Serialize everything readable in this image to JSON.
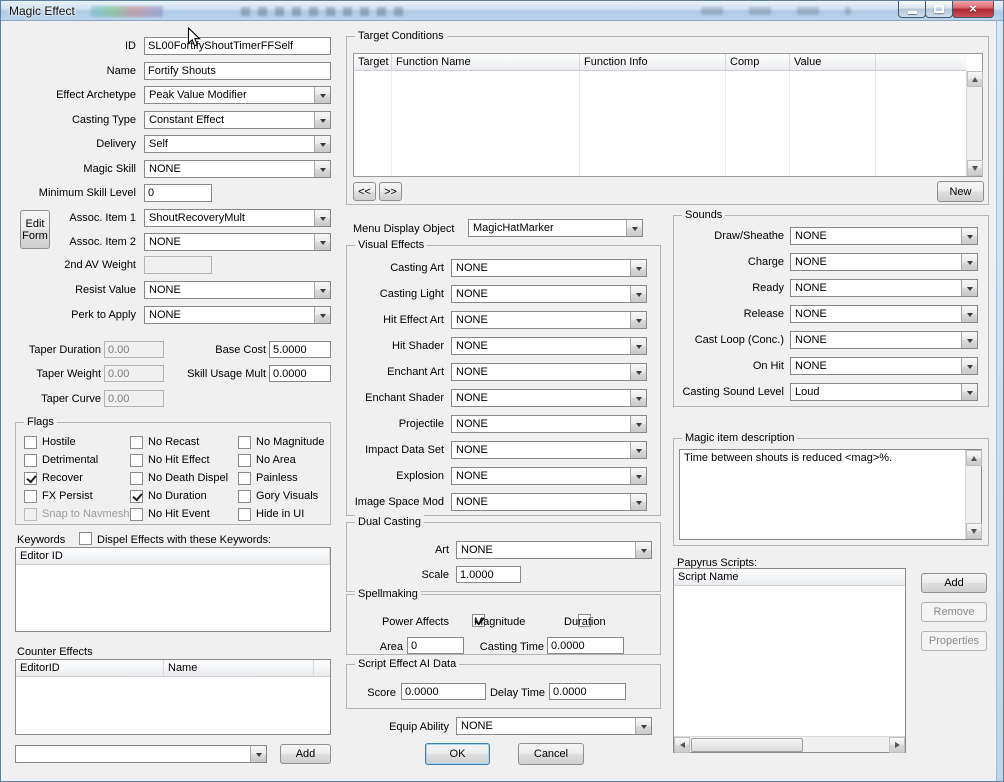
{
  "window": {
    "title": "Magic Effect"
  },
  "left": {
    "id": {
      "label": "ID",
      "value": "SL00FortifyShoutTimerFFSelf"
    },
    "name": {
      "label": "Name",
      "value": "Fortify Shouts"
    },
    "effect_archetype": {
      "label": "Effect Archetype",
      "value": "Peak Value Modifier"
    },
    "casting_type": {
      "label": "Casting Type",
      "value": "Constant Effect"
    },
    "delivery": {
      "label": "Delivery",
      "value": "Self"
    },
    "magic_skill": {
      "label": "Magic Skill",
      "value": "NONE"
    },
    "minimum_skill_level": {
      "label": "Minimum Skill Level",
      "value": "0"
    },
    "edit_form_button": "Edit Form",
    "assoc_item_1": {
      "label": "Assoc. Item 1",
      "value": "ShoutRecoveryMult"
    },
    "assoc_item_2": {
      "label": "Assoc. Item 2",
      "value": "NONE"
    },
    "second_av_weight": {
      "label": "2nd AV Weight",
      "value": ""
    },
    "resist_value": {
      "label": "Resist Value",
      "value": "NONE"
    },
    "perk_to_apply": {
      "label": "Perk to Apply",
      "value": "NONE"
    },
    "taper_duration": {
      "label": "Taper Duration",
      "value": "0.00"
    },
    "taper_weight": {
      "label": "Taper Weight",
      "value": "0.00"
    },
    "taper_curve": {
      "label": "Taper Curve",
      "value": "0.00"
    },
    "base_cost": {
      "label": "Base Cost",
      "value": "5.0000"
    },
    "skill_usage_mult": {
      "label": "Skill Usage Mult",
      "value": "0.0000"
    }
  },
  "flags": {
    "title": "Flags",
    "columns": [
      [
        {
          "label": "Hostile",
          "checked": false,
          "cls": ""
        },
        {
          "label": "Detrimental",
          "checked": false,
          "cls": ""
        },
        {
          "label": "Recover",
          "checked": true,
          "cls": ""
        },
        {
          "label": "FX Persist",
          "checked": false,
          "cls": ""
        },
        {
          "label": "Snap to Navmesh",
          "checked": false,
          "cls": "disabled"
        }
      ],
      [
        {
          "label": "No Recast",
          "checked": false,
          "cls": ""
        },
        {
          "label": "No Hit Effect",
          "checked": false,
          "cls": ""
        },
        {
          "label": "No Death Dispel",
          "checked": false,
          "cls": ""
        },
        {
          "label": "No Duration",
          "checked": true,
          "cls": ""
        },
        {
          "label": "No Hit Event",
          "checked": false,
          "cls": ""
        }
      ],
      [
        {
          "label": "No Magnitude",
          "checked": false,
          "cls": ""
        },
        {
          "label": "No Area",
          "checked": false,
          "cls": ""
        },
        {
          "label": "Painless",
          "checked": false,
          "cls": ""
        },
        {
          "label": "Gory Visuals",
          "checked": false,
          "cls": ""
        },
        {
          "label": "Hide in UI",
          "checked": false,
          "cls": ""
        }
      ]
    ]
  },
  "keywords": {
    "title": "Keywords",
    "dispel_checkbox": {
      "label": "Dispel Effects with these Keywords:",
      "checked": false
    },
    "list_header": "Editor ID"
  },
  "counter_effects": {
    "title": "Counter Effects",
    "columns": [
      "EditorID",
      "Name"
    ],
    "combo_value": "",
    "add_button": "Add"
  },
  "target_conditions": {
    "title": "Target Conditions",
    "columns": [
      "Target",
      "Function Name",
      "Function Info",
      "Comp",
      "Value"
    ],
    "prev_button": "<<",
    "next_button": ">>",
    "new_button": "New"
  },
  "menu_display_object": {
    "label": "Menu Display Object",
    "value": "MagicHatMarker"
  },
  "visual_effects": {
    "title": "Visual Effects",
    "rows": [
      {
        "label": "Casting Art",
        "value": "NONE"
      },
      {
        "label": "Casting Light",
        "value": "NONE"
      },
      {
        "label": "Hit Effect Art",
        "value": "NONE"
      },
      {
        "label": "Hit Shader",
        "value": "NONE"
      },
      {
        "label": "Enchant Art",
        "value": "NONE"
      },
      {
        "label": "Enchant Shader",
        "value": "NONE"
      },
      {
        "label": "Projectile",
        "value": "NONE"
      },
      {
        "label": "Impact Data Set",
        "value": "NONE"
      },
      {
        "label": "Explosion",
        "value": "NONE"
      },
      {
        "label": "Image Space Mod",
        "value": "NONE"
      }
    ]
  },
  "dual_casting": {
    "title": "Dual Casting",
    "art": {
      "label": "Art",
      "value": "NONE"
    },
    "scale": {
      "label": "Scale",
      "value": "1.0000"
    }
  },
  "spellmaking": {
    "title": "Spellmaking",
    "power_affects_label": "Power Affects",
    "magnitude": {
      "label": "Magnitude",
      "checked": true
    },
    "duration": {
      "label": "Duration",
      "checked": false
    },
    "area": {
      "label": "Area",
      "value": "0"
    },
    "casting_time": {
      "label": "Casting Time",
      "value": "0.0000"
    }
  },
  "script_ai": {
    "title": "Script Effect AI Data",
    "score": {
      "label": "Score",
      "value": "0.0000"
    },
    "delay_time": {
      "label": "Delay Time",
      "value": "0.0000"
    }
  },
  "equip_ability": {
    "label": "Equip Ability",
    "value": "NONE"
  },
  "dialog_buttons": {
    "ok": "OK",
    "cancel": "Cancel"
  },
  "sounds": {
    "title": "Sounds",
    "rows": [
      {
        "label": "Draw/Sheathe",
        "value": "NONE"
      },
      {
        "label": "Charge",
        "value": "NONE"
      },
      {
        "label": "Ready",
        "value": "NONE"
      },
      {
        "label": "Release",
        "value": "NONE"
      },
      {
        "label": "Cast Loop (Conc.)",
        "value": "NONE"
      },
      {
        "label": "On Hit",
        "value": "NONE"
      },
      {
        "label": "Casting Sound Level",
        "value": "Loud"
      }
    ]
  },
  "description": {
    "title": "Magic item description",
    "text": "Time between shouts is reduced <mag>%."
  },
  "papyrus": {
    "title": "Papyrus Scripts:",
    "list_header": "Script Name",
    "add_button": "Add",
    "remove_button": "Remove",
    "properties_button": "Properties"
  }
}
